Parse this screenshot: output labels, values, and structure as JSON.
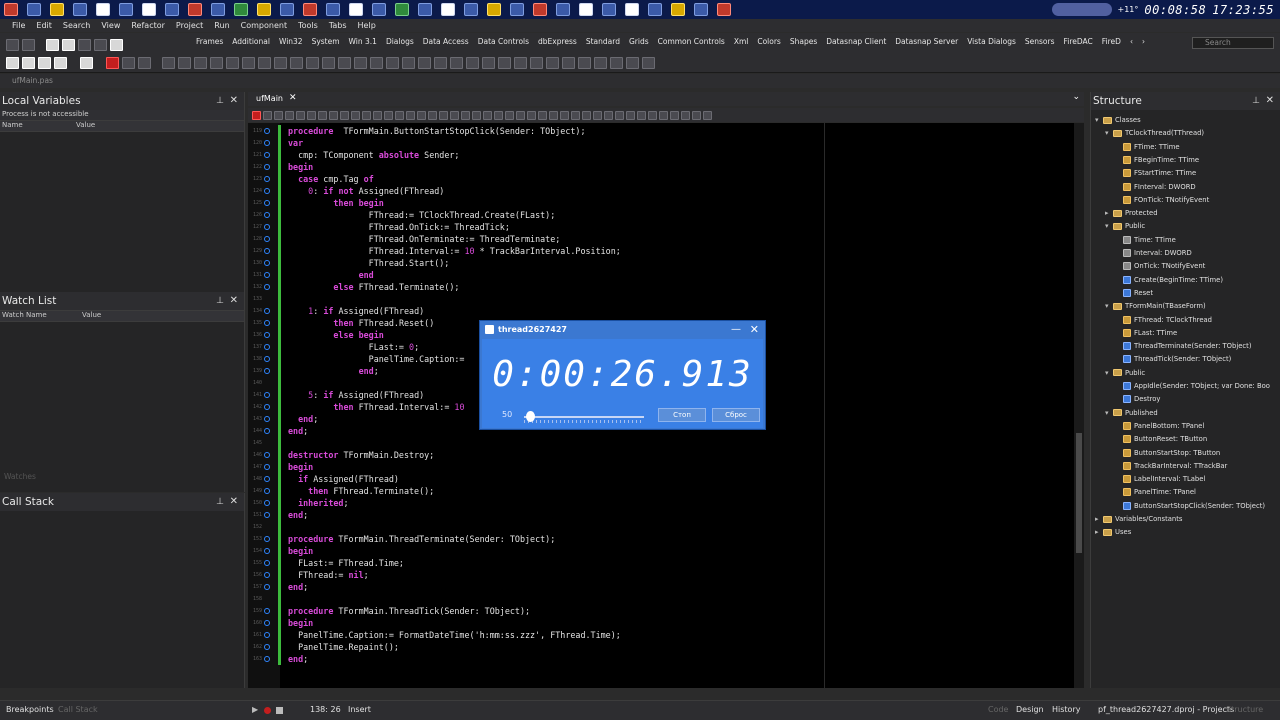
{
  "taskbar": {
    "clock_elapsed": "00:08:58",
    "clock_time": "17:23:55",
    "temp": "+11°"
  },
  "menu": [
    "File",
    "Edit",
    "Search",
    "View",
    "Refactor",
    "Project",
    "Run",
    "Component",
    "Tools",
    "Tabs",
    "Help"
  ],
  "palette_tabs": [
    "Frames",
    "Additional",
    "Win32",
    "System",
    "Win 3.1",
    "Dialogs",
    "Data Access",
    "Data Controls",
    "dbExpress",
    "Standard",
    "Grids",
    "Common Controls",
    "Xml",
    "Colors",
    "Shapes",
    "Datasnap Client",
    "Datasnap Server",
    "Vista Dialogs",
    "Sensors",
    "FireDAC",
    "FireD"
  ],
  "palette_search_placeholder": "Search",
  "file_strip": "ufMain.pas",
  "local_variables": {
    "title": "Local Variables",
    "process_msg": "Process is not accessible",
    "columns": [
      "Name",
      "Value"
    ]
  },
  "watch_list": {
    "title": "Watch List",
    "columns": [
      "Watch Name",
      "Value"
    ],
    "faint_tab": "Watches"
  },
  "call_stack": {
    "title": "Call Stack"
  },
  "editor_tab": "ufMain",
  "code": [
    {
      "n": "119",
      "t": [
        [
          "kw",
          "procedure"
        ],
        [
          "",
          "  TFormMain.ButtonStartStopClick(Sender: TObject);"
        ]
      ]
    },
    {
      "n": "120",
      "t": [
        [
          "kw",
          "var"
        ]
      ]
    },
    {
      "n": "121",
      "t": [
        [
          "",
          "  cmp: TComponent "
        ],
        [
          "kw",
          "absolute"
        ],
        [
          "",
          " Sender;"
        ]
      ]
    },
    {
      "n": "122",
      "t": [
        [
          "kw",
          "begin"
        ]
      ]
    },
    {
      "n": "123",
      "t": [
        [
          "",
          "  "
        ],
        [
          "kw",
          "case"
        ],
        [
          "",
          " cmp.Tag "
        ],
        [
          "kw",
          "of"
        ]
      ]
    },
    {
      "n": "124",
      "t": [
        [
          "",
          "    "
        ],
        [
          "num",
          "0"
        ],
        [
          "",
          ": "
        ],
        [
          "kw",
          "if not"
        ],
        [
          "",
          " Assigned(FThread)"
        ]
      ]
    },
    {
      "n": "125",
      "t": [
        [
          "",
          "         "
        ],
        [
          "kw",
          "then begin"
        ]
      ]
    },
    {
      "n": "126",
      "t": [
        [
          "",
          "                FThread:= TClockThread.Create(FLast);"
        ]
      ]
    },
    {
      "n": "127",
      "t": [
        [
          "",
          "                FThread.OnTick:= ThreadTick;"
        ]
      ]
    },
    {
      "n": "128",
      "t": [
        [
          "",
          "                FThread.OnTerminate:= ThreadTerminate;"
        ]
      ]
    },
    {
      "n": "129",
      "t": [
        [
          "",
          "                FThread.Interval:= "
        ],
        [
          "num",
          "10"
        ],
        [
          "",
          " * TrackBarInterval.Position;"
        ]
      ]
    },
    {
      "n": "130",
      "t": [
        [
          "",
          "                FThread.Start();"
        ]
      ]
    },
    {
      "n": "131",
      "t": [
        [
          "",
          "              "
        ],
        [
          "kw",
          "end"
        ]
      ]
    },
    {
      "n": "132",
      "t": [
        [
          "",
          "         "
        ],
        [
          "kw",
          "else"
        ],
        [
          "",
          " FThread.Terminate();"
        ]
      ]
    },
    {
      "n": "133",
      "t": []
    },
    {
      "n": "134",
      "t": [
        [
          "",
          "    "
        ],
        [
          "num",
          "1"
        ],
        [
          "",
          ": "
        ],
        [
          "kw",
          "if"
        ],
        [
          "",
          " Assigned(FThread)"
        ]
      ]
    },
    {
      "n": "135",
      "t": [
        [
          "",
          "         "
        ],
        [
          "kw",
          "then"
        ],
        [
          "",
          " FThread.Reset()"
        ]
      ]
    },
    {
      "n": "136",
      "t": [
        [
          "",
          "         "
        ],
        [
          "kw",
          "else begin"
        ]
      ]
    },
    {
      "n": "137",
      "t": [
        [
          "",
          "                FLast:= "
        ],
        [
          "num",
          "0"
        ],
        [
          "",
          ";"
        ]
      ]
    },
    {
      "n": "138",
      "t": [
        [
          "",
          "                PanelTime.Caption:="
        ]
      ]
    },
    {
      "n": "139",
      "t": [
        [
          "",
          "              "
        ],
        [
          "kw",
          "end"
        ],
        [
          "",
          ";"
        ]
      ]
    },
    {
      "n": "140",
      "t": []
    },
    {
      "n": "141",
      "t": [
        [
          "",
          "    "
        ],
        [
          "num",
          "5"
        ],
        [
          "",
          ": "
        ],
        [
          "kw",
          "if"
        ],
        [
          "",
          " Assigned(FThread)"
        ]
      ]
    },
    {
      "n": "142",
      "t": [
        [
          "",
          "         "
        ],
        [
          "kw",
          "then"
        ],
        [
          "",
          " FThread.Interval:= "
        ],
        [
          "num",
          "10"
        ]
      ]
    },
    {
      "n": "143",
      "t": [
        [
          "",
          "  "
        ],
        [
          "kw",
          "end"
        ],
        [
          "",
          ";"
        ]
      ]
    },
    {
      "n": "144",
      "t": [
        [
          "kw",
          "end"
        ],
        [
          "",
          ";"
        ]
      ]
    },
    {
      "n": "145",
      "t": []
    },
    {
      "n": "146",
      "t": [
        [
          "kw",
          "destructor"
        ],
        [
          "",
          " TFormMain.Destroy;"
        ]
      ]
    },
    {
      "n": "147",
      "t": [
        [
          "kw",
          "begin"
        ]
      ]
    },
    {
      "n": "148",
      "t": [
        [
          "",
          "  "
        ],
        [
          "kw",
          "if"
        ],
        [
          "",
          " Assigned(FThread)"
        ]
      ]
    },
    {
      "n": "149",
      "t": [
        [
          "",
          "    "
        ],
        [
          "kw",
          "then"
        ],
        [
          "",
          " FThread.Terminate();"
        ]
      ]
    },
    {
      "n": "150",
      "t": [
        [
          "",
          "  "
        ],
        [
          "kw",
          "inherited"
        ],
        [
          "",
          ";"
        ]
      ]
    },
    {
      "n": "151",
      "t": [
        [
          "kw",
          "end"
        ],
        [
          "",
          ";"
        ]
      ]
    },
    {
      "n": "152",
      "t": []
    },
    {
      "n": "153",
      "t": [
        [
          "kw",
          "procedure"
        ],
        [
          "",
          " TFormMain.ThreadTerminate(Sender: TObject);"
        ]
      ]
    },
    {
      "n": "154",
      "t": [
        [
          "kw",
          "begin"
        ]
      ]
    },
    {
      "n": "155",
      "t": [
        [
          "",
          "  FLast:= FThread.Time;"
        ]
      ]
    },
    {
      "n": "156",
      "t": [
        [
          "",
          "  FThread:= "
        ],
        [
          "kw",
          "nil"
        ],
        [
          "",
          ";"
        ]
      ]
    },
    {
      "n": "157",
      "t": [
        [
          "kw",
          "end"
        ],
        [
          "",
          ";"
        ]
      ]
    },
    {
      "n": "158",
      "t": []
    },
    {
      "n": "159",
      "t": [
        [
          "kw",
          "procedure"
        ],
        [
          "",
          " TFormMain.ThreadTick(Sender: TObject);"
        ]
      ]
    },
    {
      "n": "160",
      "t": [
        [
          "kw",
          "begin"
        ]
      ]
    },
    {
      "n": "161",
      "t": [
        [
          "",
          "  PanelTime.Caption:= FormatDateTime("
        ],
        [
          "str",
          "'h:mm:ss.zzz'"
        ],
        [
          "",
          ", FThread.Time);"
        ]
      ]
    },
    {
      "n": "162",
      "t": [
        [
          "",
          "  PanelTime.Repaint();"
        ]
      ]
    },
    {
      "n": "163",
      "t": [
        [
          "kw",
          "end"
        ],
        [
          "",
          ";"
        ]
      ]
    }
  ],
  "dialog": {
    "title": "thread2627427",
    "time": "0:00:26.913",
    "interval": "50",
    "stop_button": "Стоп",
    "reset_button": "Сброс",
    "slider_position": 0.02
  },
  "structure": {
    "title": "Structure",
    "tree": [
      {
        "d": 0,
        "tw": "▾",
        "ic": "",
        "t": "Classes"
      },
      {
        "d": 1,
        "tw": "▾",
        "ic": "",
        "t": "TClockThread(TThread)"
      },
      {
        "d": 2,
        "tw": "",
        "ic": "f",
        "t": "FTime: TTime"
      },
      {
        "d": 2,
        "tw": "",
        "ic": "f",
        "t": "FBeginTime: TTime"
      },
      {
        "d": 2,
        "tw": "",
        "ic": "f",
        "t": "FStartTime: TTime"
      },
      {
        "d": 2,
        "tw": "",
        "ic": "f",
        "t": "FInterval: DWORD"
      },
      {
        "d": 2,
        "tw": "",
        "ic": "f",
        "t": "FOnTick: TNotifyEvent"
      },
      {
        "d": 1,
        "tw": "▸",
        "ic": "",
        "t": "Protected"
      },
      {
        "d": 1,
        "tw": "▾",
        "ic": "",
        "t": "Public"
      },
      {
        "d": 2,
        "tw": "",
        "ic": "p",
        "t": "Time: TTime"
      },
      {
        "d": 2,
        "tw": "",
        "ic": "p",
        "t": "Interval: DWORD"
      },
      {
        "d": 2,
        "tw": "",
        "ic": "p",
        "t": "OnTick: TNotifyEvent"
      },
      {
        "d": 2,
        "tw": "",
        "ic": "m",
        "t": "Create(BeginTime: TTime)"
      },
      {
        "d": 2,
        "tw": "",
        "ic": "m",
        "t": "Reset"
      },
      {
        "d": 1,
        "tw": "▾",
        "ic": "",
        "t": "TFormMain(TBaseForm)"
      },
      {
        "d": 2,
        "tw": "",
        "ic": "f",
        "t": "FThread: TClockThread"
      },
      {
        "d": 2,
        "tw": "",
        "ic": "f",
        "t": "FLast: TTime"
      },
      {
        "d": 2,
        "tw": "",
        "ic": "m",
        "t": "ThreadTerminate(Sender: TObject)"
      },
      {
        "d": 2,
        "tw": "",
        "ic": "m",
        "t": "ThreadTick(Sender: TObject)"
      },
      {
        "d": 1,
        "tw": "▾",
        "ic": "",
        "t": "Public"
      },
      {
        "d": 2,
        "tw": "",
        "ic": "m",
        "t": "AppIdle(Sender: TObject; var Done: Boo"
      },
      {
        "d": 2,
        "tw": "",
        "ic": "m",
        "t": "Destroy"
      },
      {
        "d": 1,
        "tw": "▾",
        "ic": "",
        "t": "Published"
      },
      {
        "d": 2,
        "tw": "",
        "ic": "f",
        "t": "PanelBottom: TPanel"
      },
      {
        "d": 2,
        "tw": "",
        "ic": "f",
        "t": "ButtonReset: TButton"
      },
      {
        "d": 2,
        "tw": "",
        "ic": "f",
        "t": "ButtonStartStop: TButton"
      },
      {
        "d": 2,
        "tw": "",
        "ic": "f",
        "t": "TrackBarInterval: TTrackBar"
      },
      {
        "d": 2,
        "tw": "",
        "ic": "f",
        "t": "LabelInterval: TLabel"
      },
      {
        "d": 2,
        "tw": "",
        "ic": "f",
        "t": "PanelTime: TPanel"
      },
      {
        "d": 2,
        "tw": "",
        "ic": "m",
        "t": "ButtonStartStopClick(Sender: TObject)"
      },
      {
        "d": 0,
        "tw": "▸",
        "ic": "",
        "t": "Variables/Constants"
      },
      {
        "d": 0,
        "tw": "▸",
        "ic": "",
        "t": "Uses"
      }
    ]
  },
  "status": {
    "position": "138: 26",
    "mode": "Insert",
    "code_tab": "Code",
    "design_tab": "Design",
    "history_tab": "History",
    "project": "pf_thread2627427.dproj - Projects",
    "structure_tab": "Structure",
    "breakpoints": "Breakpoints",
    "callstack_tab": "Call Stack"
  }
}
